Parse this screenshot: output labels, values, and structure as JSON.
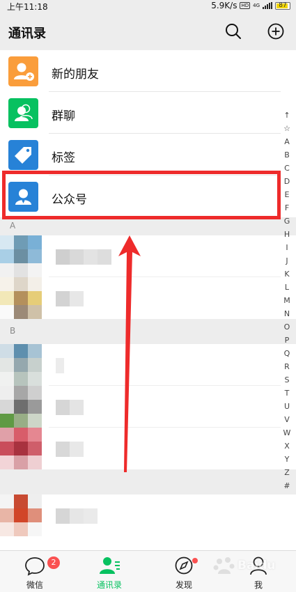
{
  "status_bar": {
    "time": "上午11:18",
    "speed": "5.9K/s",
    "hd": "HD",
    "network": "4G",
    "battery": "87",
    "battery_level": 0.87,
    "battery_color": "#f2d600"
  },
  "header": {
    "title": "通讯录",
    "icons": [
      "search-icon",
      "add-circle-icon"
    ]
  },
  "function_items": [
    {
      "label": "新的朋友",
      "color": "#fa9d3b",
      "icon": "add-friend-icon"
    },
    {
      "label": "群聊",
      "color": "#07c160",
      "icon": "group-icon"
    },
    {
      "label": "标签",
      "color": "#2782d7",
      "icon": "tag-icon"
    },
    {
      "label": "公众号",
      "color": "#2782d7",
      "icon": "official-account-icon"
    }
  ],
  "sections": [
    {
      "letter": "A"
    },
    {
      "letter": "B"
    }
  ],
  "alpha_index": [
    "↑",
    "☆",
    "A",
    "B",
    "C",
    "D",
    "E",
    "F",
    "G",
    "H",
    "I",
    "J",
    "K",
    "L",
    "M",
    "N",
    "O",
    "P",
    "Q",
    "R",
    "S",
    "T",
    "U",
    "V",
    "W",
    "X",
    "Y",
    "Z",
    "#"
  ],
  "tabs": [
    {
      "label": "微信",
      "icon": "chat-icon",
      "badge": "2"
    },
    {
      "label": "通讯录",
      "icon": "contacts-icon",
      "active": true
    },
    {
      "label": "发现",
      "icon": "compass-icon",
      "dot": true
    },
    {
      "label": "我",
      "icon": "me-icon"
    }
  ],
  "colors": {
    "accent": "#07c160",
    "annotation": "#ee2b2b",
    "badge": "#fa5151"
  },
  "watermark": "Baidu"
}
